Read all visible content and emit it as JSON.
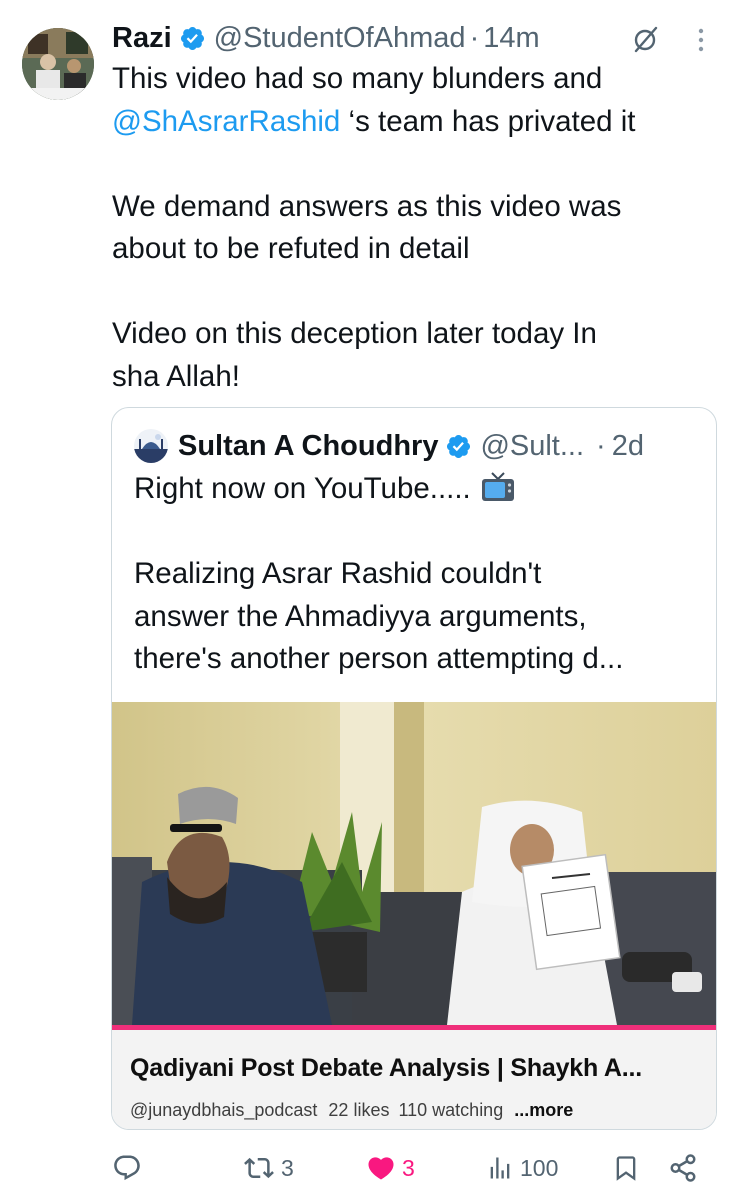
{
  "tweet": {
    "author_name": "Razi",
    "author_handle": "@StudentOfAhmad",
    "separator": "·",
    "time": "14m",
    "lines": [
      {
        "text": "This video had so many blunders and"
      },
      {
        "mention": "@ShAsrarRashid",
        "text": " ‘s team has privated it"
      },
      {
        "text": "We demand answers as this video was"
      },
      {
        "text": "about to be refuted in detail"
      },
      {
        "text": "Video on this deception later today In"
      },
      {
        "text": "sha Allah!"
      }
    ]
  },
  "quote": {
    "author_name": "Sultan A Choudhry",
    "author_handle": "@Sult...",
    "separator": "·",
    "time": "2d",
    "line1": "Right now on YouTube.....",
    "line2": "Realizing Asrar Rashid couldn't",
    "line3": "answer the Ahmadiyya arguments,",
    "line4": "there's another person attempting d..."
  },
  "youtube_card": {
    "title": "Qadiyani Post Debate Analysis | Shaykh A...",
    "channel": "@junaydbhais_podcast",
    "likes": "22 likes",
    "watching": "110 watching",
    "more": "...more"
  },
  "actions": {
    "replies": "",
    "reposts": "3",
    "likes": "3",
    "views": "100"
  },
  "colors": {
    "accent": "#1d9bf0",
    "like": "#f91880",
    "text": "#0f1419",
    "secondary": "#536471"
  },
  "icons": [
    "verified-badge-icon",
    "grok-icon",
    "more-options-icon",
    "tv-emoji-icon",
    "reply-icon",
    "repost-icon",
    "like-icon",
    "views-icon",
    "bookmark-icon",
    "share-icon"
  ]
}
